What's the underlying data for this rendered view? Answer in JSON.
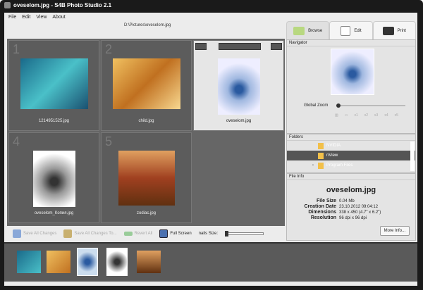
{
  "window": {
    "title": "oveselom.jpg - S4B Photo Studio 2.1"
  },
  "menu": [
    "File",
    "Edit",
    "View",
    "About"
  ],
  "path": "D:\\Pictures\\oveselom.jpg",
  "grid": [
    {
      "num": "1",
      "name": "1214951525.jpg",
      "color": "#2a8aa8"
    },
    {
      "num": "2",
      "name": "child.jpg",
      "color": "#d98a2a"
    },
    {
      "num": "3",
      "name": "oveselom.jpg",
      "color": "#7a9ad0"
    },
    {
      "num": "4",
      "name": "oveselom_Копия.jpg",
      "color": "#bbbbbb"
    },
    {
      "num": "5",
      "name": "zodiac.jpg",
      "color": "#c0602a"
    }
  ],
  "toolbar": {
    "save_all": "Save All Changes",
    "save_all_to": "Save All Changes To...",
    "revert": "Revert All",
    "full_screen": "Full Screen",
    "thumb_size": "nails Size:"
  },
  "tabs": [
    "Browse",
    "Edit",
    "Print"
  ],
  "navigator": {
    "title": "Navigator",
    "zoom_label": "Global Zoom",
    "zoom_levels": [
      "x1",
      "x2",
      "x3",
      "x4",
      "x5"
    ]
  },
  "folders": {
    "title": "Folders",
    "items": [
      "NVIDIA",
      "nView",
      "Program Files"
    ]
  },
  "file_info": {
    "title": "File Info",
    "name": "oveselom.jpg",
    "rows": [
      [
        "File Size",
        "0.04 Mb"
      ],
      [
        "Creation Date",
        "23.10.2012  09:04:12"
      ],
      [
        "Dimensions",
        "338 x 450 (4.7\" x 6.2\")"
      ],
      [
        "Resolution",
        "96 dpi x 96 dpi"
      ]
    ],
    "more": "More Info..."
  }
}
